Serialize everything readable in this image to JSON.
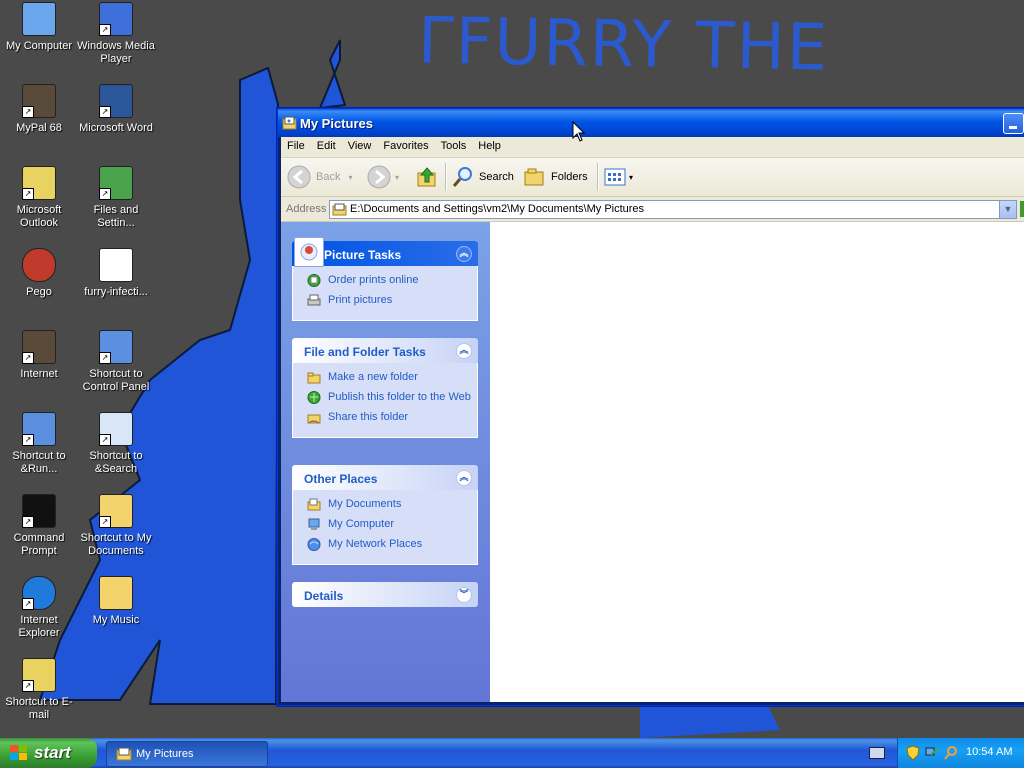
{
  "wallpaper": {
    "text": "ΓFURRY THE"
  },
  "desktop": {
    "icons": [
      {
        "label": "My Computer",
        "icon": "my-computer-icon",
        "shortcut": false
      },
      {
        "label": "Windows Media Player",
        "icon": "media-player-icon",
        "shortcut": true
      },
      {
        "label": "MyPal 68",
        "icon": "mypal-icon",
        "shortcut": true
      },
      {
        "label": "Microsoft Word",
        "icon": "word-icon",
        "shortcut": true
      },
      {
        "label": "Microsoft Outlook",
        "icon": "outlook-icon",
        "shortcut": true
      },
      {
        "label": "Files and Settin...",
        "icon": "files-settings-icon",
        "shortcut": true
      },
      {
        "label": "Pego",
        "icon": "pego-icon",
        "shortcut": false
      },
      {
        "label": "furry-infecti...",
        "icon": "image-file-icon",
        "shortcut": false
      },
      {
        "label": "Internet",
        "icon": "internet-icon",
        "shortcut": true
      },
      {
        "label": "Shortcut to Control Panel",
        "icon": "control-panel-icon",
        "shortcut": true
      },
      {
        "label": "Shortcut to &Run...",
        "icon": "run-icon",
        "shortcut": true
      },
      {
        "label": "Shortcut to &Search",
        "icon": "search-icon",
        "shortcut": true
      },
      {
        "label": "Command Prompt",
        "icon": "command-prompt-icon",
        "shortcut": true
      },
      {
        "label": "Shortcut to My Documents",
        "icon": "documents-folder-icon",
        "shortcut": true
      },
      {
        "label": "Internet Explorer",
        "icon": "internet-explorer-icon",
        "shortcut": true
      },
      {
        "label": "My Music",
        "icon": "music-folder-icon",
        "shortcut": false
      },
      {
        "label": "Shortcut to E-mail",
        "icon": "email-icon",
        "shortcut": true
      }
    ]
  },
  "window": {
    "title": "My Pictures",
    "menu": [
      "File",
      "Edit",
      "View",
      "Favorites",
      "Tools",
      "Help"
    ],
    "toolbar": {
      "back": "Back",
      "search": "Search",
      "folders": "Folders"
    },
    "address": {
      "label": "Address",
      "value": "E:\\Documents and Settings\\vm2\\My Documents\\My Pictures"
    },
    "panels": {
      "picture_tasks": {
        "title": "Picture Tasks",
        "items": [
          "Order prints online",
          "Print pictures"
        ]
      },
      "file_folder_tasks": {
        "title": "File and Folder Tasks",
        "items": [
          "Make a new folder",
          "Publish this folder to the Web",
          "Share this folder"
        ]
      },
      "other_places": {
        "title": "Other Places",
        "items": [
          "My Documents",
          "My Computer",
          "My Network Places"
        ]
      },
      "details": {
        "title": "Details"
      }
    }
  },
  "taskbar": {
    "start": "start",
    "task": "My Pictures",
    "clock": "10:54 AM"
  },
  "colors": {
    "desktop_bg": "#4a4a4a",
    "wallpaper_blue": "#1f55d6",
    "titlebar": "#0055e5",
    "taskpane": "#6f8ee0",
    "link": "#215dc6"
  }
}
